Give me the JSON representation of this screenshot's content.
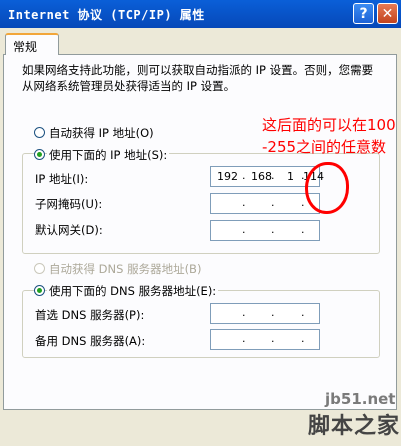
{
  "window": {
    "title": "Internet 协议 (TCP/IP) 属性",
    "help_label": "?",
    "close_label": "✕"
  },
  "tab": {
    "label": "常规"
  },
  "intro": "如果网络支持此功能，则可以获取自动指派的 IP 设置。否则，您需要从网络系统管理员处获得适当的 IP 设置。",
  "ip_section": {
    "auto_label": "自动获得 IP 地址(O)",
    "manual_label": "使用下面的 IP 地址(S):",
    "selected": "manual",
    "ip_label": "IP 地址(I):",
    "ip_octets": [
      "192",
      "168",
      "1",
      "114"
    ],
    "subnet_label": "子网掩码(U):",
    "gateway_label": "默认网关(D):"
  },
  "dns_section": {
    "auto_label": "自动获得 DNS 服务器地址(B)",
    "manual_label": "使用下面的 DNS 服务器地址(E):",
    "selected": "manual",
    "preferred_label": "首选 DNS 服务器(P):",
    "alternate_label": "备用 DNS 服务器(A):"
  },
  "annotation": {
    "line1": "这后面的可以在100",
    "line2": "-255之间的任意数"
  },
  "watermark": {
    "url": "jb51.net",
    "brand": "脚本之家"
  },
  "colors": {
    "titlebar": "#0a5fd8",
    "annotation": "#ff0000",
    "radio_checked": "#21a121"
  },
  "icons": {
    "help": "help-icon",
    "close": "close-icon"
  }
}
